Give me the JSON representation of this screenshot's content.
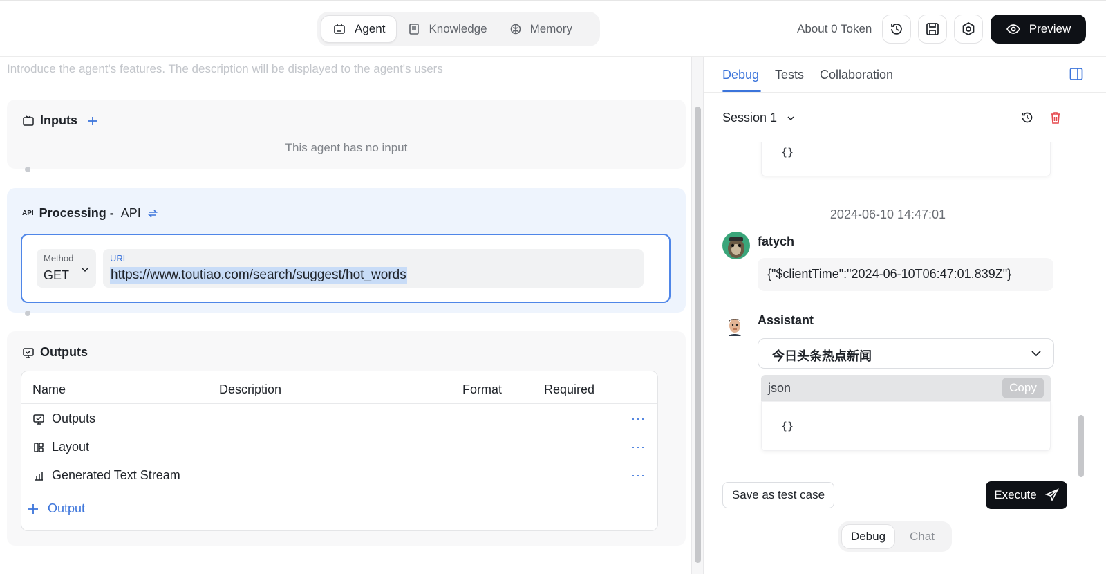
{
  "header": {
    "tabs": [
      {
        "label": "Agent",
        "icon": "robot-icon",
        "active": true
      },
      {
        "label": "Knowledge",
        "icon": "book-icon",
        "active": false
      },
      {
        "label": "Memory",
        "icon": "brain-icon",
        "active": false
      }
    ],
    "token_label": "About 0 Token",
    "preview_label": "Preview"
  },
  "editor": {
    "description_placeholder": "Introduce the agent's features. The description will be displayed to the agent's users",
    "inputs": {
      "title": "Inputs",
      "empty_text": "This agent has no input"
    },
    "processing": {
      "title": "Processing -",
      "type": "API",
      "method_label": "Method",
      "method_value": "GET",
      "url_label": "URL",
      "url_value": "https://www.toutiao.com/search/suggest/hot_words"
    },
    "outputs": {
      "title": "Outputs",
      "columns": [
        "Name",
        "Description",
        "Format",
        "Required"
      ],
      "rows": [
        {
          "name": "Outputs",
          "icon": "output-icon"
        },
        {
          "name": "Layout",
          "icon": "layout-icon"
        },
        {
          "name": "Generated Text Stream",
          "icon": "text-stream-icon"
        }
      ],
      "add_label": "Output",
      "more_label": "···"
    }
  },
  "panel": {
    "tabs": [
      {
        "label": "Debug",
        "active": true
      },
      {
        "label": "Tests",
        "active": false
      },
      {
        "label": "Collaboration",
        "active": false
      }
    ],
    "session_label": "Session 1",
    "chat": {
      "prev_code": "{}",
      "timestamp": "2024-06-10 14:47:01",
      "user_name": "fatych",
      "user_message": "{\"$clientTime\":\"2024-06-10T06:47:01.839Z\"}",
      "assistant_name": "Assistant",
      "dropdown_value": "今日头条热点新闻",
      "code_lang": "json",
      "copy_label": "Copy",
      "code_content": "{}"
    },
    "footer": {
      "save_label": "Save as test case",
      "execute_label": "Execute",
      "modes": [
        {
          "label": "Debug",
          "active": true
        },
        {
          "label": "Chat",
          "active": false
        }
      ]
    }
  },
  "colors": {
    "accent": "#3b74db",
    "dark": "#0e1116",
    "delete": "#e5484d"
  }
}
